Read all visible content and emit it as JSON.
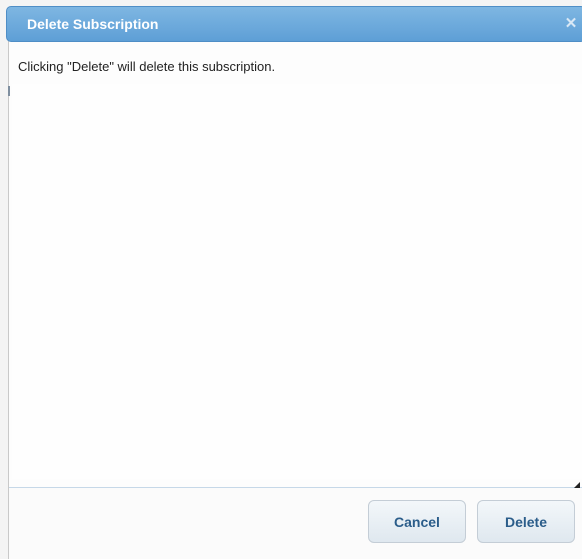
{
  "dialog": {
    "title": "Delete Subscription",
    "close_glyph": "✕",
    "close_icon": "close-icon",
    "message": "Clicking \"Delete\" will delete this subscription.",
    "buttons": {
      "cancel_label": "Cancel",
      "delete_label": "Delete"
    }
  },
  "colors": {
    "titlebar": "#6aa7dc",
    "button_text": "#2b5d8a"
  }
}
